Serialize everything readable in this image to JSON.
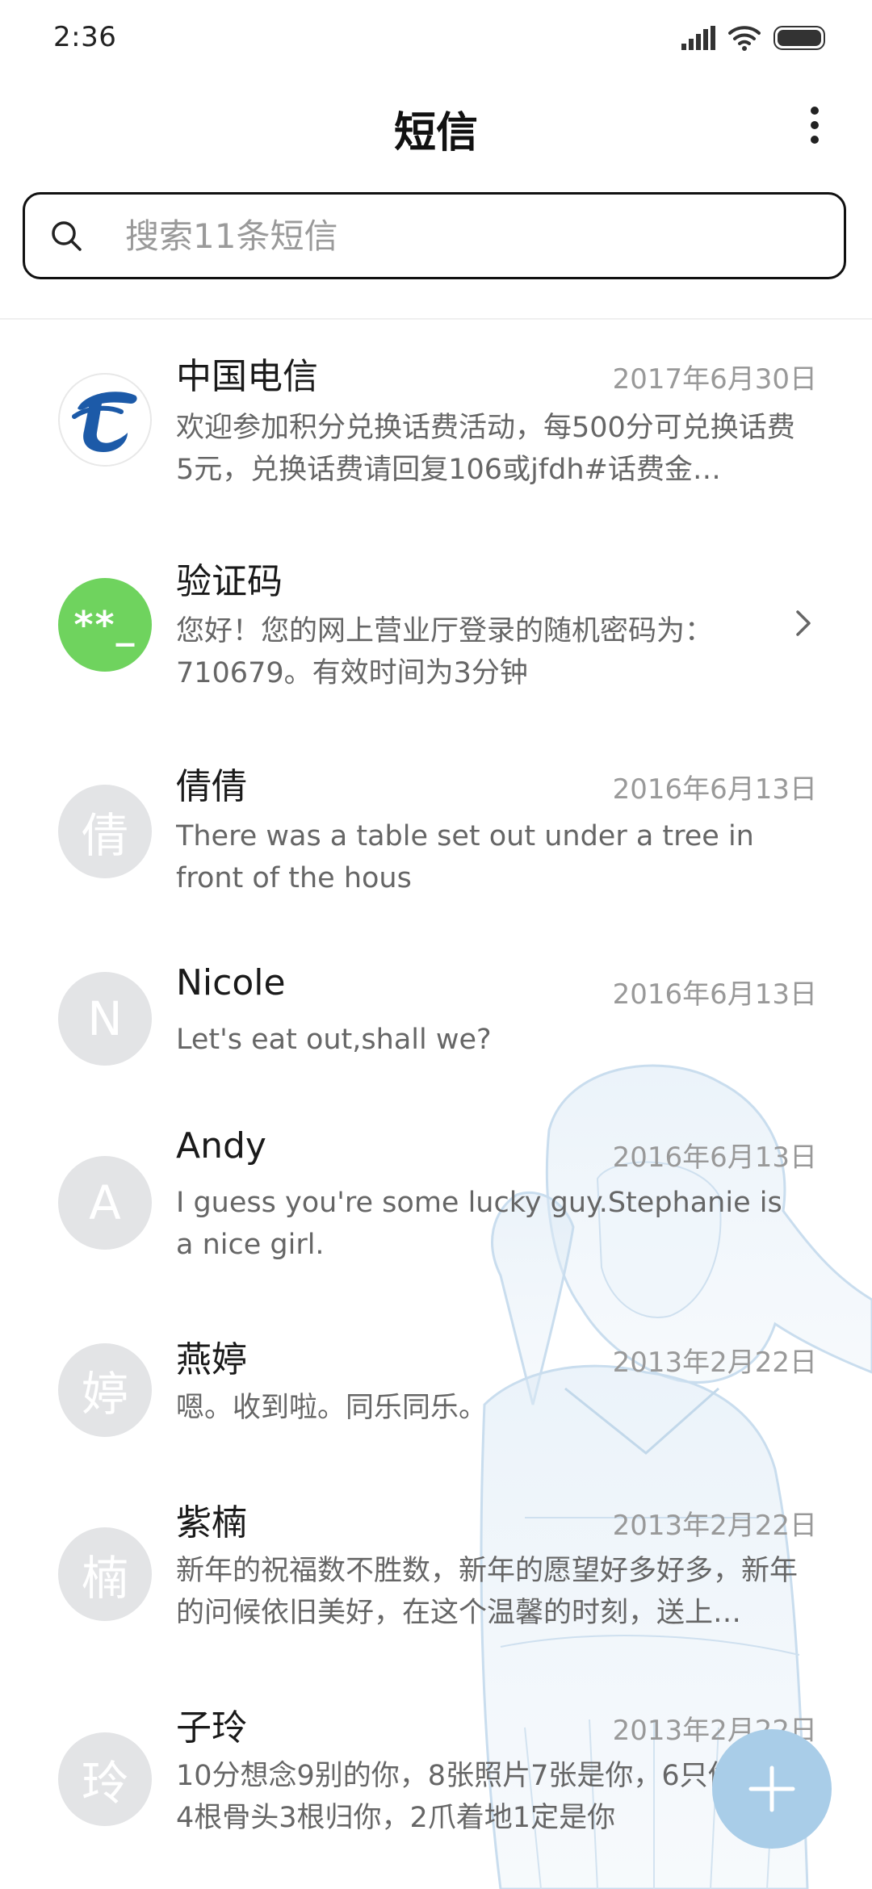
{
  "status_bar": {
    "time": "2:36"
  },
  "header": {
    "title": "短信"
  },
  "search": {
    "placeholder": "搜索11条短信"
  },
  "conversations": [
    {
      "name": "中国电信",
      "date": "2017年6月30日",
      "preview": "欢迎参加积分兑换话费活动，每500分可兑换话费5元，兑换话费请回复106或jfdh#话费金…",
      "avatar": {
        "type": "logo",
        "icon": "china-telecom-logo"
      }
    },
    {
      "name": "验证码",
      "date": "",
      "preview": "您好！您的网上营业厅登录的随机密码为：710679。有效时间为3分钟",
      "avatar": {
        "type": "code",
        "text": "**_"
      }
    },
    {
      "name": "倩倩",
      "date": "2016年6月13日",
      "preview": "There was a table set out under a tree in front of the hous",
      "avatar": {
        "type": "letter",
        "text": "倩"
      }
    },
    {
      "name": "Nicole",
      "date": "2016年6月13日",
      "preview": "Let's eat out,shall we?",
      "avatar": {
        "type": "letter",
        "text": "N"
      }
    },
    {
      "name": "Andy",
      "date": "2016年6月13日",
      "preview": "I guess you're some lucky guy.Stephanie is a nice girl.",
      "avatar": {
        "type": "letter",
        "text": "A"
      }
    },
    {
      "name": "燕婷",
      "date": "2013年2月22日",
      "preview": "嗯。收到啦。同乐同乐。",
      "avatar": {
        "type": "letter",
        "text": "婷"
      }
    },
    {
      "name": "紫楠",
      "date": "2013年2月22日",
      "preview": "新年的祝福数不胜数，新年的愿望好多好多，新年的问候依旧美好，在这个温馨的时刻，送上…",
      "avatar": {
        "type": "letter",
        "text": "楠"
      }
    },
    {
      "name": "子玲",
      "date": "2013年2月22日",
      "preview": "10分想念9别的你，8张照片7张是你，6只像你，4根骨头3根归你，2爪着地1定是你",
      "avatar": {
        "type": "letter",
        "text": "玲"
      }
    }
  ],
  "fab": {
    "icon": "plus-icon"
  },
  "colors": {
    "avatar_letter_bg": "#e3e4e6",
    "avatar_code_bg": "#6fd35e",
    "telecom_blue": "#1c5aa8",
    "fab_bg": "#a9cde8"
  }
}
